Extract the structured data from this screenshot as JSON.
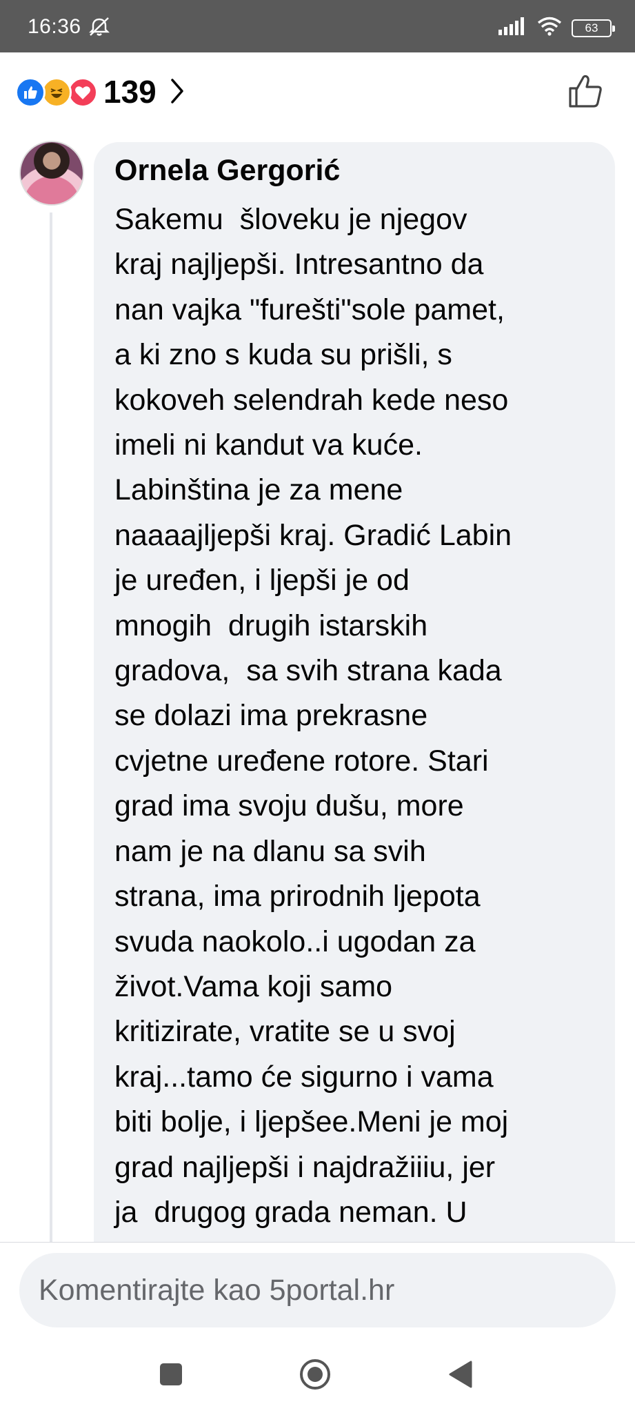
{
  "status_bar": {
    "time": "16:36",
    "battery_level": "63",
    "icons": [
      "dnd-off-icon",
      "signal-icon",
      "wifi-icon",
      "battery-icon"
    ]
  },
  "reactions": {
    "types": [
      "like",
      "haha",
      "love"
    ],
    "count": "139",
    "colors": {
      "like": "#1877f2",
      "haha": "#f7b125",
      "love": "#f33e58"
    }
  },
  "comment": {
    "author": "Ornela Gergorić",
    "lines": [
      "Sakemu  šloveku je njegov",
      "kraj najljepši. Intresantno da",
      "nan vajka \"furešti\"sole pamet,",
      "a ki zno s kuda su prišli, s",
      "kokoveh selendrah kede neso",
      "imeli ni kandut va kuće.",
      "Labinština je za mene",
      "naaaajljepši kraj. Gradić Labin",
      "je uređen, i ljepši je od",
      "mnogih  drugih istarskih",
      "gradova,  sa svih strana kada",
      "se dolazi ima prekrasne",
      "cvjetne uređene rotore. Stari",
      "grad ima svoju dušu, more",
      "nam je na dlanu sa svih",
      "strana, ima prirodnih ljepota",
      "svuda naokolo..i ugodan za",
      "život.Vama koji samo",
      "kritizirate, vratite se u svoj",
      "kraj...tamo će sigurno i vama",
      "biti bolje, i ljepšee.Meni je moj",
      "grad najljepši i najdražiiiu, jer",
      "ja  drugog grada neman. U"
    ]
  },
  "composer": {
    "placeholder": "Komentirajte kao 5portal.hr"
  },
  "navigation": {
    "buttons": [
      "recents",
      "home",
      "back"
    ]
  },
  "theme": {
    "bubble": "#f0f2f5",
    "text": "#050505",
    "muted": "#65676b",
    "statusbar": "#5a5a5a"
  }
}
